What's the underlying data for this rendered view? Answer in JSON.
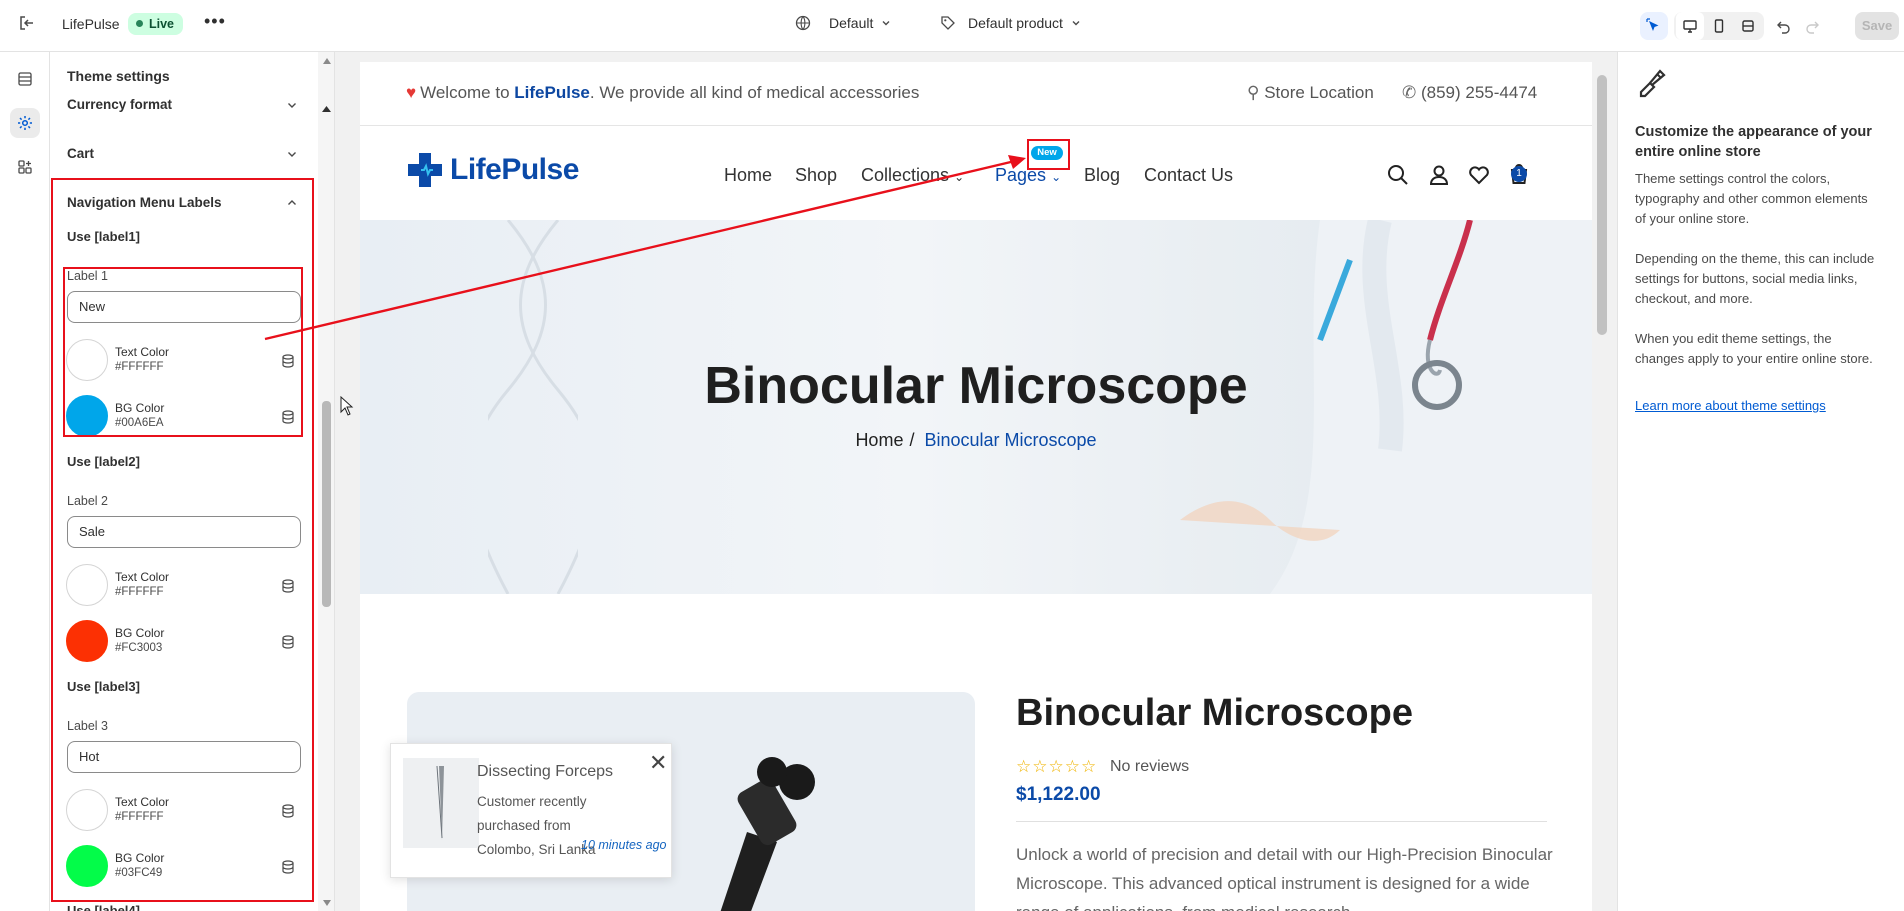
{
  "topbar": {
    "store_name": "LifePulse",
    "status": "Live",
    "theme_selector": "Default",
    "template_selector": "Default product",
    "save_label": "Save"
  },
  "settings_panel": {
    "title": "Theme settings",
    "sections": {
      "currency": "Currency format",
      "cart": "Cart",
      "nav_labels": "Navigation Menu Labels"
    },
    "labels": [
      {
        "use": "Use [label1]",
        "field_label": "Label 1",
        "value": "New",
        "text_color_name": "Text Color",
        "text_color": "#FFFFFF",
        "bg_color_name": "BG Color",
        "bg_color": "#00A6EA"
      },
      {
        "use": "Use [label2]",
        "field_label": "Label 2",
        "value": "Sale",
        "text_color_name": "Text Color",
        "text_color": "#FFFFFF",
        "bg_color_name": "BG Color",
        "bg_color": "#FC3003"
      },
      {
        "use": "Use [label3]",
        "field_label": "Label 3",
        "value": "Hot",
        "text_color_name": "Text Color",
        "text_color": "#FFFFFF",
        "bg_color_name": "BG Color",
        "bg_color": "#03FC49"
      }
    ],
    "next_section": "Use [label4]"
  },
  "storefront": {
    "welcome_prefix": "Welcome to",
    "welcome_brand": "LifePulse",
    "welcome_suffix": ". We provide all kind of medical accessories",
    "store_location": "Store Location",
    "phone": "(859) 255-4474",
    "logo_text": "LifePulse",
    "nav": [
      "Home",
      "Shop",
      "Collections",
      "Pages",
      "Blog",
      "Contact Us"
    ],
    "new_badge": "New",
    "cart_count": "1",
    "hero_title": "Binocular Microscope",
    "crumb_home": "Home",
    "crumb_sep": "/",
    "crumb_current": "Binocular Microscope",
    "product_title": "Binocular Microscope",
    "stars": "☆☆☆☆☆",
    "reviews": "No reviews",
    "price": "$1,122.00",
    "description": "Unlock a world of precision and detail with our High-Precision Binocular Microscope. This advanced optical instrument is designed for a wide range of applications, from medical research",
    "popup": {
      "title": "Dissecting Forceps",
      "body": "Customer recently purchased from Colombo, Sri Lanka",
      "time": "10 minutes ago"
    }
  },
  "info_panel": {
    "title": "Customize the appearance of your entire online store",
    "p1": "Theme settings control the colors, typography and other common elements of your online store.",
    "p2": "Depending on the theme, this can include settings for buttons, social media links, checkout, and more.",
    "p3": "When you edit theme settings, the changes apply to your entire online store.",
    "link": "Learn more about theme settings"
  },
  "colors": {
    "accent": "#005bd3",
    "brand": "#0b4aa8",
    "annotation": "#e8101b"
  }
}
